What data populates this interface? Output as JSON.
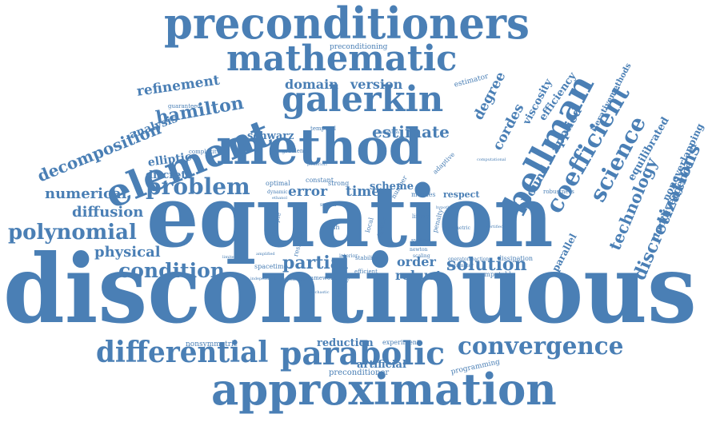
{
  "word_color": "#4a7fb5",
  "words": {
    "discontinuous": "discontinuous",
    "equation": "equation",
    "method": "method",
    "approximation": "approximation",
    "preconditioners": "preconditioners",
    "mathematic": "mathematic",
    "galerkin": "galerkin",
    "element": "element",
    "bellman": "bellman",
    "parabolic": "parabolic",
    "differential": "differential",
    "convergence": "convergence",
    "problem": "problem",
    "coefficient": "coefficient",
    "science": "science",
    "polynomial": "polynomial",
    "condition": "condition",
    "partial": "partial",
    "solution": "solution",
    "decomposition": "decomposition",
    "hamilton": "hamilton",
    "numerical": "numerical",
    "diffusion": "diffusion",
    "physical": "physical",
    "estimate": "estimate",
    "error": "error",
    "time": "time",
    "technology": "technology",
    "discretizations": "discretizations",
    "refinement": "refinement",
    "analysis": "analysis",
    "domain": "domain",
    "version": "version",
    "degree": "degree",
    "cordes": "cordes",
    "elliptic": "elliptic",
    "discrete": "discrete",
    "robust": "robust",
    "order": "order",
    "bound": "bound",
    "applied": "applied",
    "schwarz": "schwarz",
    "scheme": "scheme",
    "nondivergence": "nondivergence",
    "nonoverlapping": "nonoverlapping",
    "equilibrated": "equilibrated",
    "viscosity": "viscosity",
    "efficiency": "efficiency",
    "iterativemethods": "iterativemethods",
    "parallel": "parallel",
    "reduction": "reduction",
    "artificial": "artificial",
    "nonsymmetric": "nonsymmetric",
    "preconditioner": "preconditioner",
    "programming": "programming",
    "experiment": "experiment",
    "preconditioning": "preconditioning",
    "estimator": "estimator",
    "guaranteed": "guaranteed",
    "complexity": "complexity",
    "respect": "respect",
    "meshes": "meshes",
    "computable": "computable",
    "dissipation": "dissipation",
    "robustness": "robustness",
    "principle": "principle",
    "optimal": "optimal",
    "constant": "constant",
    "strong": "strong",
    "gradient": "gradient",
    "temporal": "temporal",
    "efficient": "efficient",
    "stability": "stability",
    "spacetime": "spacetime",
    "framework": "framework",
    "dependent": "dependent",
    "space": "space",
    "system": "system",
    "penalty": "penalty",
    "mesh": "mesh",
    "lifting": "lifting",
    "adaptive": "adaptive",
    "residual": "residual",
    "number": "number",
    "local": "local",
    "dynamic": "dynamic",
    "ethanol": "ethanol",
    "spatial": "spatial",
    "scaling": "scaling",
    "newton": "newton",
    "symmetric": "symmetric",
    "operator": "operator",
    "reaction": "reaction",
    "parameter": "parameter",
    "amplified": "amplified",
    "interior": "interior",
    "maximum": "maximum",
    "stochastic": "stochastic",
    "independent": "independent",
    "limited": "limited",
    "certified": "certified",
    "computational": "computational",
    "combination": "combination",
    "posteriori": "posteriori",
    "hypothesis": "hypothesis"
  }
}
